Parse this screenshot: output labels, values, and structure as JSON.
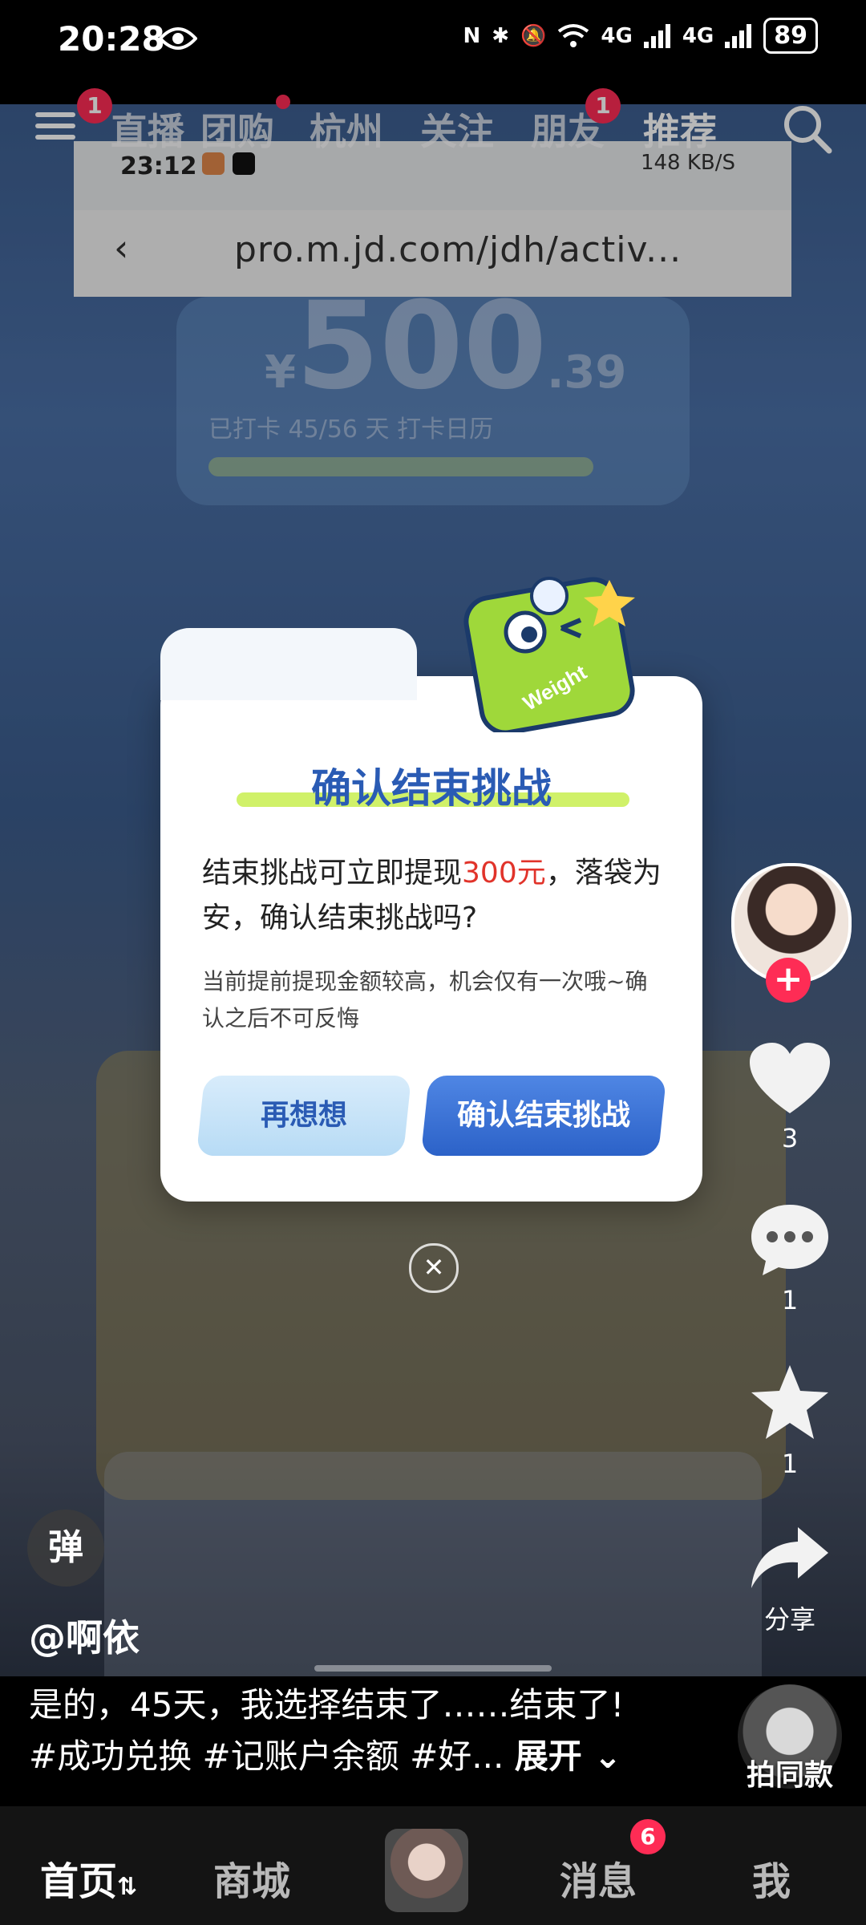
{
  "status_bar": {
    "time": "20:28",
    "battery": "89",
    "signal_labels": [
      "N",
      "4G",
      "4G"
    ]
  },
  "top_nav": {
    "menu_badge": "1",
    "tabs": [
      "直播",
      "团购",
      "杭州",
      "关注",
      "朋友",
      "推荐"
    ],
    "friends_badge": "1"
  },
  "inner_screen": {
    "time": "23:12",
    "speed": "148 KB/S",
    "url": "pro.m.jd.com/jdh/activ..."
  },
  "background": {
    "amount_currency": "¥",
    "amount_int": "500",
    "amount_dec": ".39",
    "checkin": "已打卡 45/56 天 打卡日历"
  },
  "modal": {
    "title": "确认结束挑战",
    "message_pre": "结束挑战可立即提现",
    "message_amount": "300元",
    "message_post": "，落袋为安，确认结束挑战吗?",
    "note": "当前提前提现金额较高，机会仅有一次哦~确认之后不可反悔",
    "rethink_label": "再想想",
    "confirm_label": "确认结束挑战",
    "close_symbol": "✕",
    "mascot_text": "Weight"
  },
  "rail": {
    "follow_symbol": "+",
    "like_count": "3",
    "comment_count": "1",
    "favorite_count": "1",
    "share_label": "分享"
  },
  "caption": {
    "danmu_label": "弹",
    "author": "@啊依",
    "line1": "是的，45天，我选择结束了……结束了!",
    "line2": "#成功兑换 #记账户余额 #好...",
    "expand": "展开"
  },
  "same_style_label": "拍同款",
  "bottom_nav": {
    "home": "首页",
    "mall": "商城",
    "messages": "消息",
    "messages_badge": "6",
    "me": "我"
  },
  "colors": {
    "accent_red": "#fe2c55",
    "modal_title": "#2a5bb4",
    "highlight_amount": "#e1332a",
    "confirm_button": "#2c62c8"
  }
}
